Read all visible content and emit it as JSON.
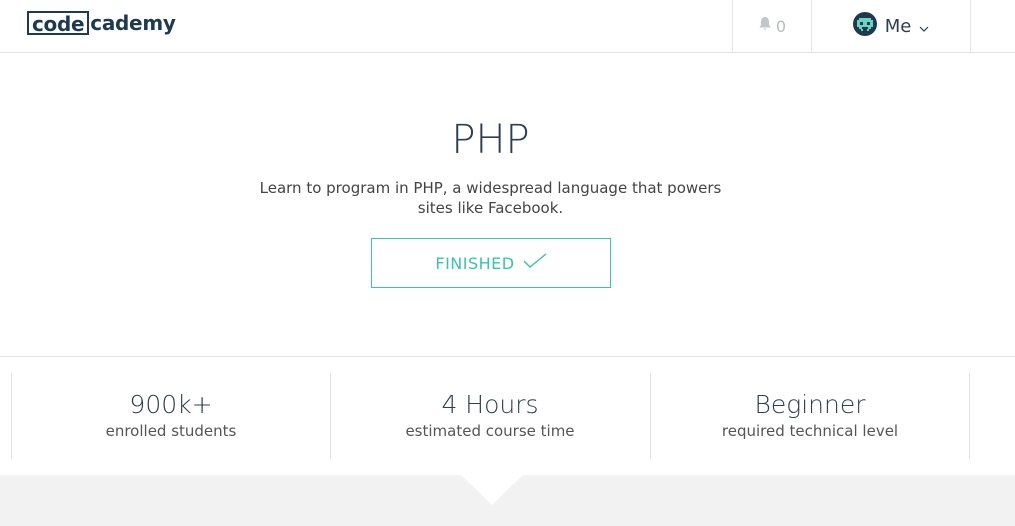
{
  "header": {
    "logo_boxed": "code",
    "logo_rest": "cademy",
    "notifications_count": "0",
    "user_label": "Me"
  },
  "hero": {
    "title": "PHP",
    "description": "Learn to program in PHP, a widespread language that powers sites like Facebook.",
    "status_button": "FINISHED"
  },
  "stats": [
    {
      "value": "900k+",
      "label": "enrolled students"
    },
    {
      "value": "4 Hours",
      "label": "estimated course time"
    },
    {
      "value": "Beginner",
      "label": "required technical level"
    }
  ],
  "colors": {
    "accent": "#3cc3a8",
    "text_dark": "#2c3e50",
    "band_bg": "#f1f2f1"
  },
  "icons": {
    "notifications": "bell-icon",
    "avatar": "space-invader-avatar",
    "menu": "chevron-down-icon",
    "status": "checkmark-icon"
  }
}
